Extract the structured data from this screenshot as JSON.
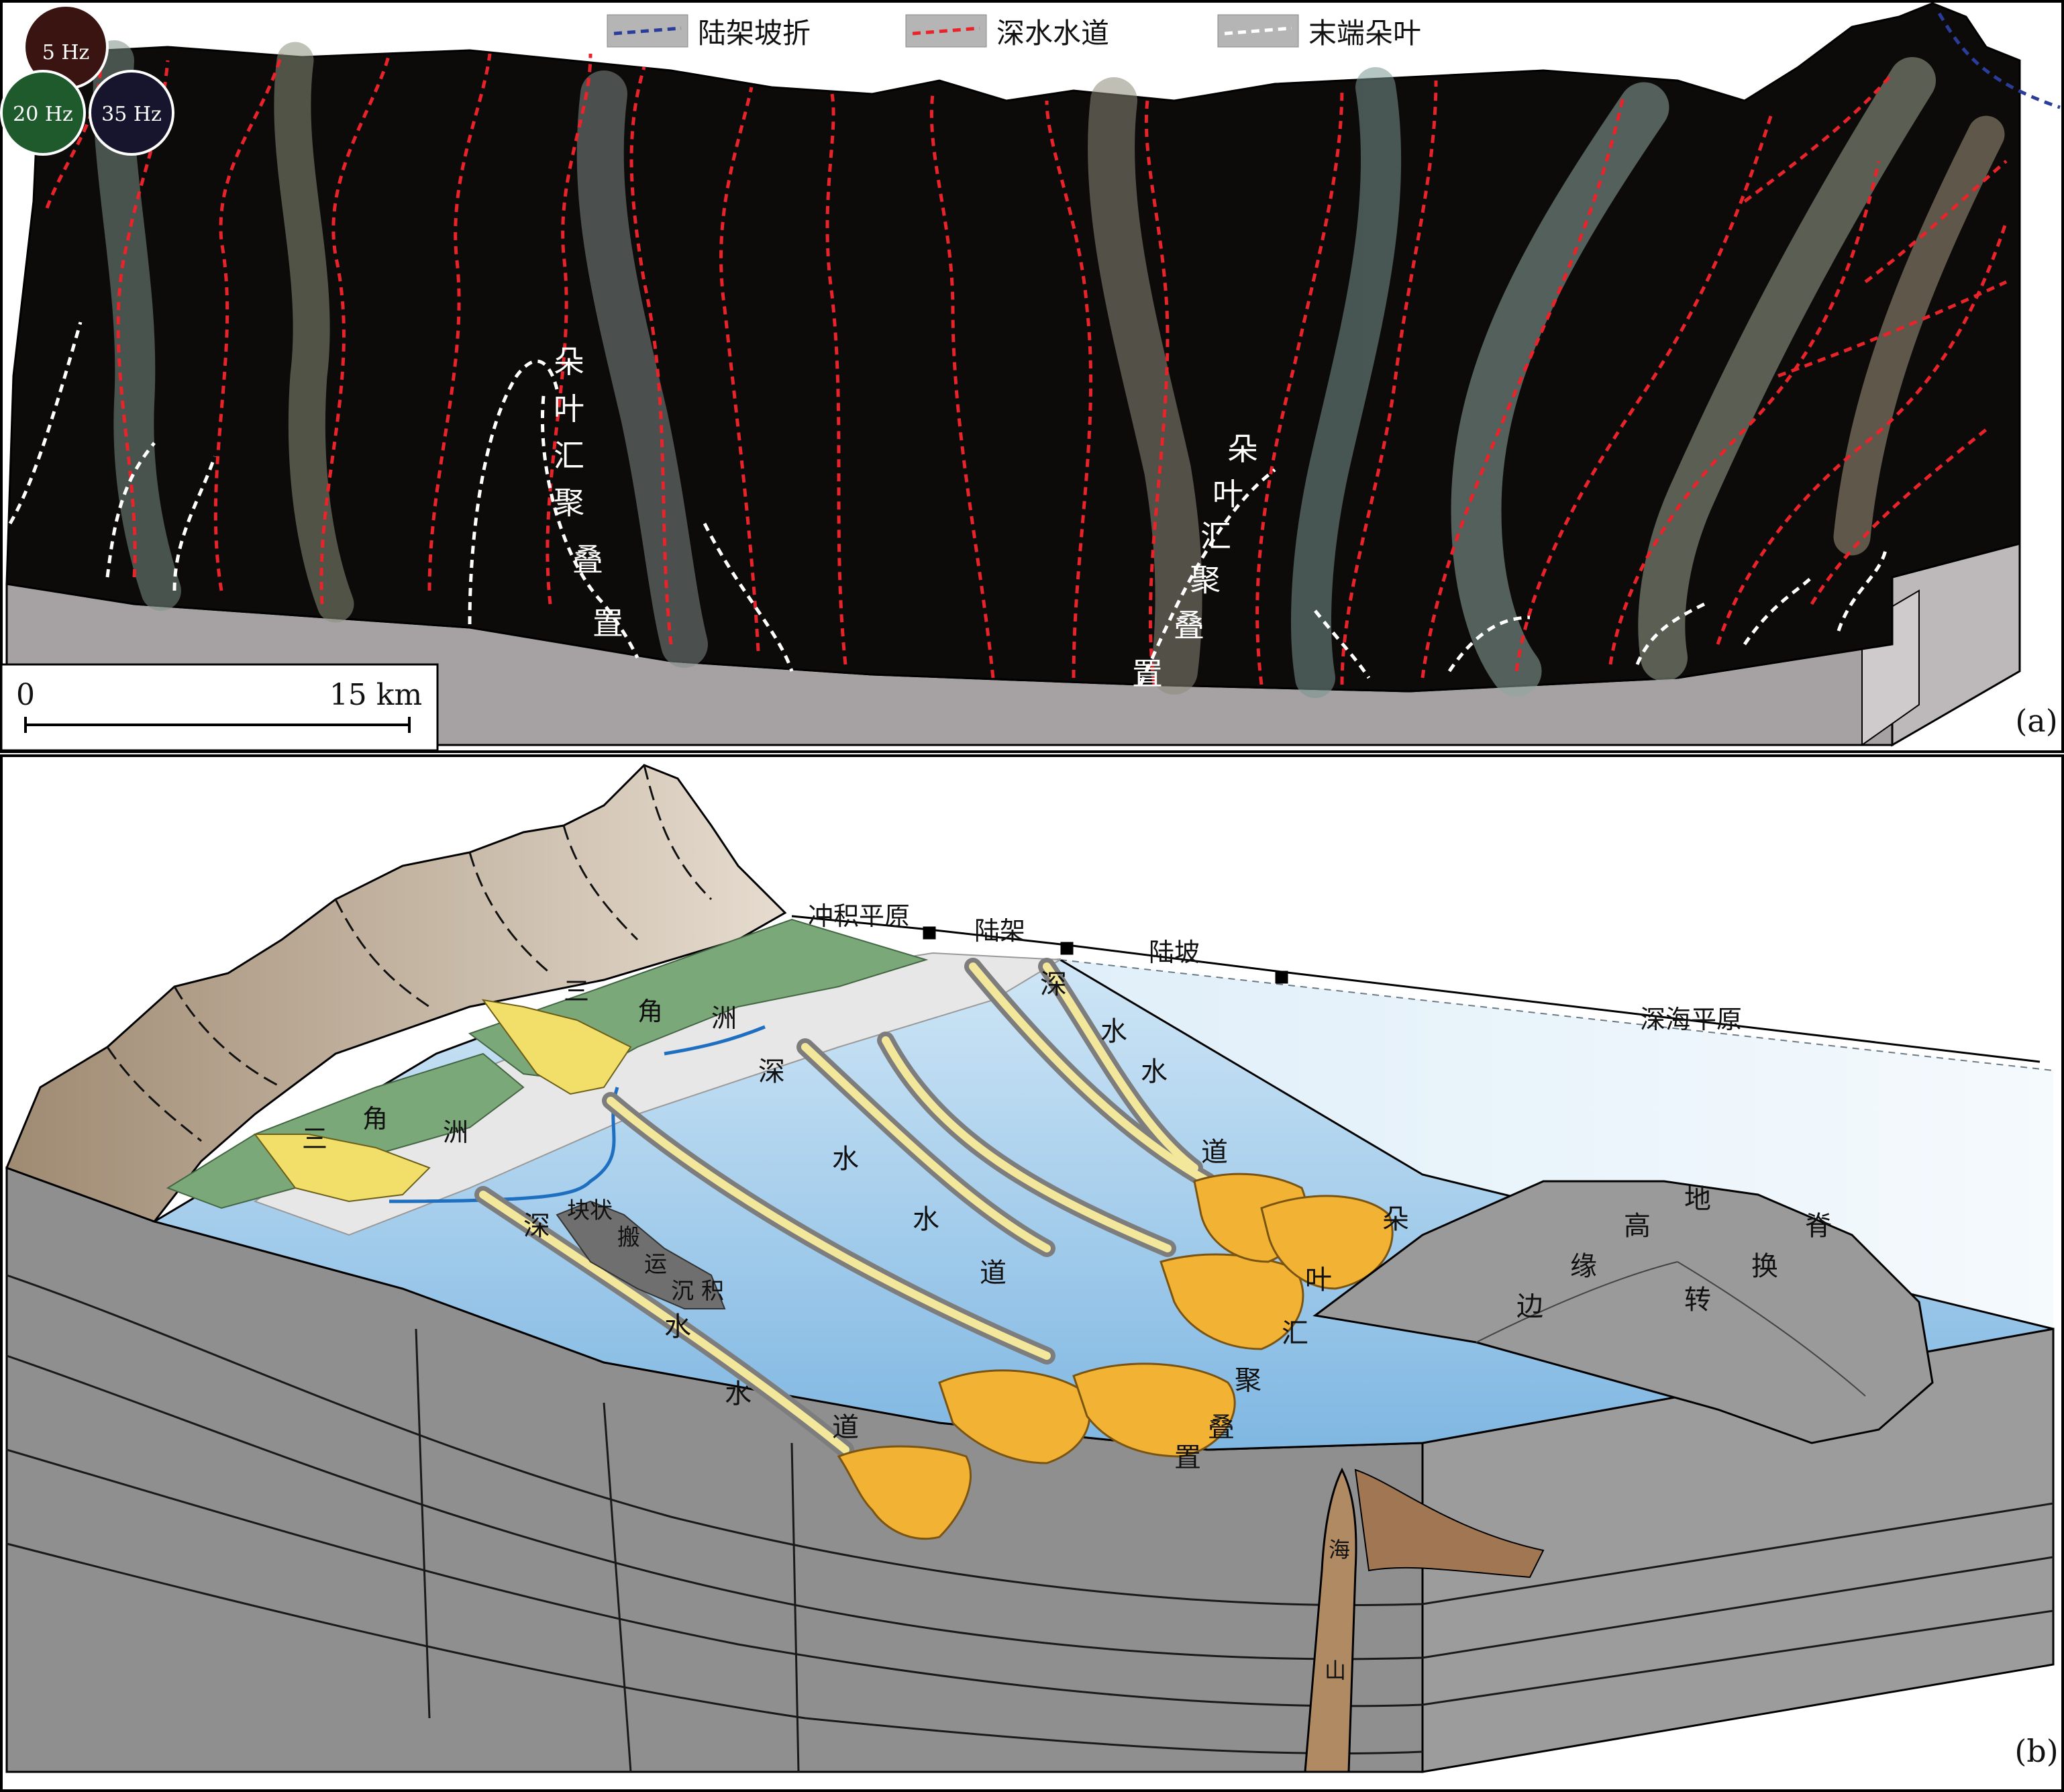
{
  "panel_a": {
    "panel_label": "(a)",
    "freq_5": "5 Hz",
    "freq_20": "20 Hz",
    "freq_35": "35 Hz",
    "legend": [
      {
        "label": "陆架坡折",
        "color": "#2b3d9a"
      },
      {
        "label": "深水水道",
        "color": "#e8232a"
      },
      {
        "label": "末端朵叶",
        "color": "#ffffff"
      }
    ],
    "lobe_label_1": [
      "朵",
      "叶",
      "汇",
      "聚",
      "叠",
      "置"
    ],
    "lobe_label_2": [
      "朵",
      "叶",
      "汇",
      "聚",
      "叠",
      "置"
    ],
    "scale_start": "0",
    "scale_end": "15 km"
  },
  "panel_b": {
    "panel_label": "(b)",
    "zones": {
      "alluvial": "冲积平原",
      "shelf": "陆架",
      "slope": "陆坡",
      "abyssal": "深海平原"
    },
    "delta_1": [
      "三",
      "角",
      "洲"
    ],
    "delta_2": [
      "三",
      "角",
      "洲"
    ],
    "channel_1": [
      "深",
      "水",
      "水",
      "道"
    ],
    "channel_2": [
      "深",
      "水",
      "水",
      "道"
    ],
    "channel_3": [
      "深",
      "水",
      "水",
      "道"
    ],
    "mtd": [
      "块状",
      "搬",
      "运",
      "沉",
      "积"
    ],
    "lobes": [
      "朵",
      "叶",
      "汇",
      "聚",
      "叠",
      "置"
    ],
    "ridge": [
      "边",
      "缘",
      "高",
      "地",
      "转",
      "换",
      "脊"
    ],
    "seamount": [
      "海",
      "山"
    ]
  },
  "colors": {
    "seismic_bg": "#0d0b0a",
    "red_dash": "#e8232a",
    "blue_dash": "#2b3d9a",
    "mountain": "#b8a48c",
    "delta_green": "#7aa878",
    "lobe_orange": "#f2b234",
    "sea": "#a9d1ee",
    "block_grey": "#8f8f8f",
    "ridge_grey": "#9a9a9a"
  }
}
